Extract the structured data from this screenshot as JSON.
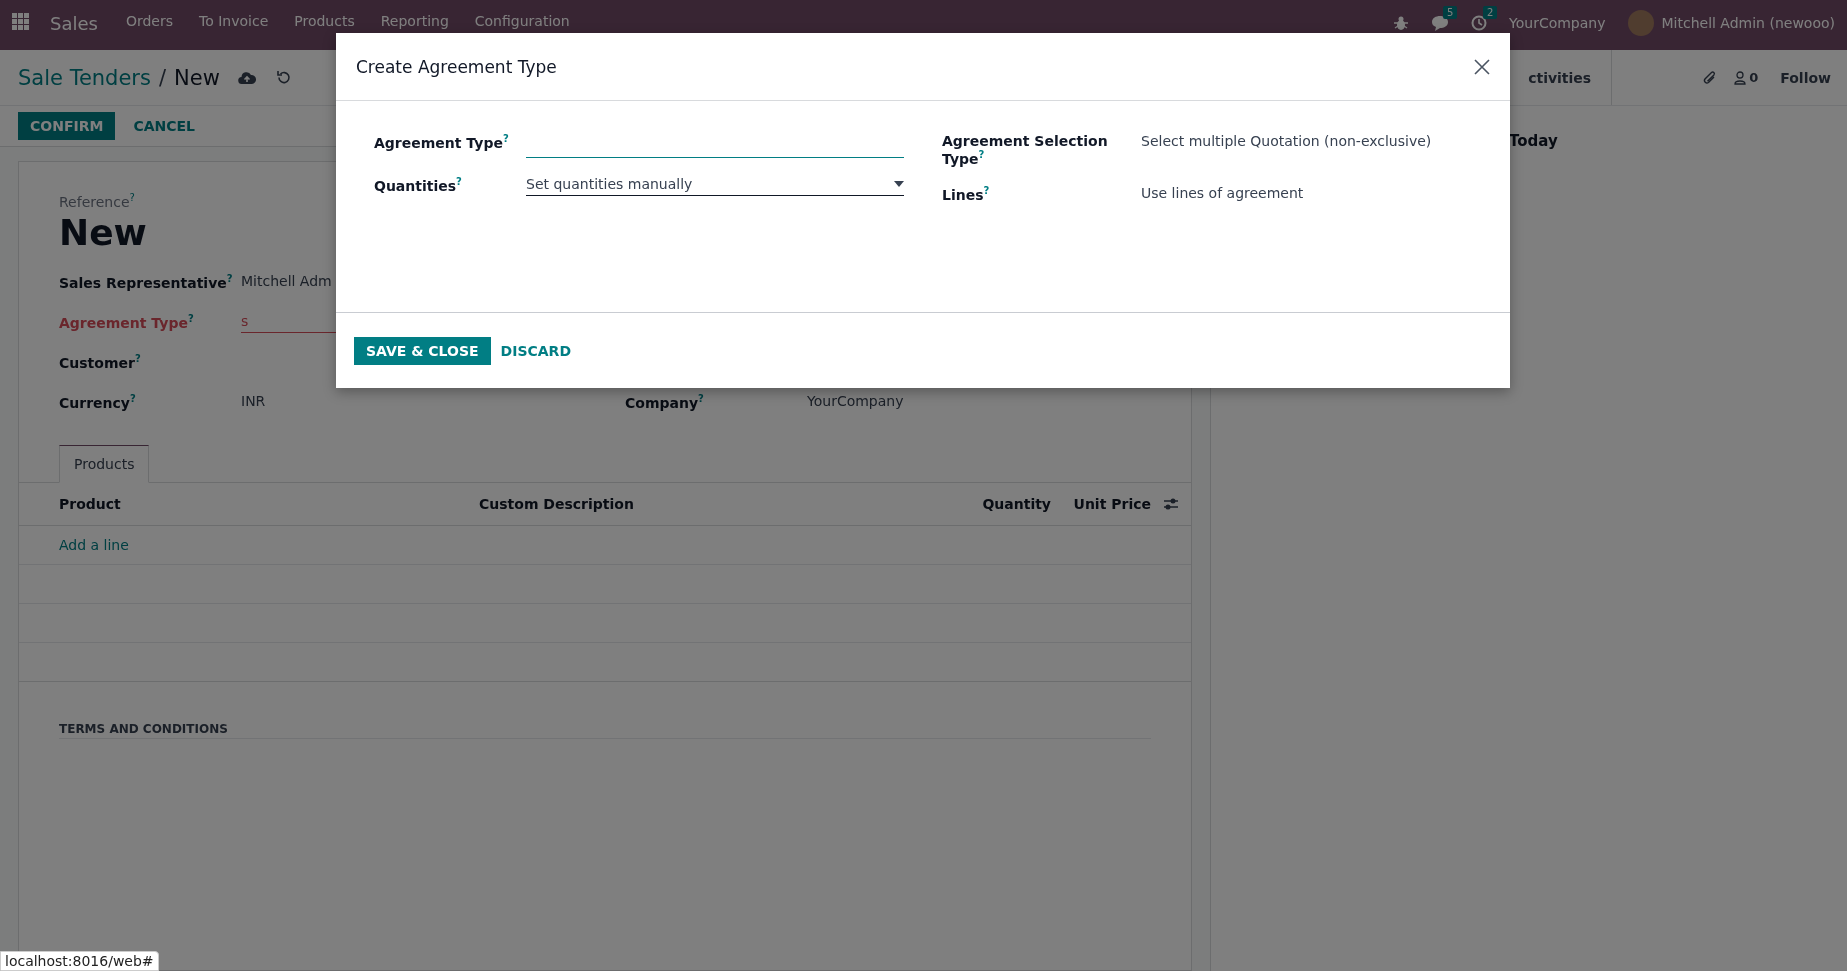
{
  "navbar": {
    "app": "Sales",
    "menu": [
      "Orders",
      "To Invoice",
      "Products",
      "Reporting",
      "Configuration"
    ],
    "messages_count": "5",
    "activities_count": "2",
    "company": "YourCompany",
    "user": "Mitchell Admin (newooo)"
  },
  "breadcrumb": {
    "parent": "Sale Tenders",
    "separator": "/",
    "current": "New"
  },
  "actions": [
    {
      "label": "CONFIRM",
      "kind": "primary"
    },
    {
      "label": "CANCEL",
      "kind": "secondary"
    }
  ],
  "chatter": {
    "activities": "ctivities",
    "followers": "0",
    "follow": "Follow",
    "today": "Today"
  },
  "form": {
    "reference_label": "Reference$^{?}$",
    "reference": "New",
    "fields": [
      {
        "label": "Sales Representative$^{?}$",
        "value": "Mitchell Adm",
        "invalid": false
      },
      {
        "label": "Agreement Type$^{?}$",
        "value": "s",
        "invalid": true
      },
      {
        "label": "Customer$^{?}$",
        "invalid": false
      },
      {
        "label": "Currency$^{?}$",
        "value": "INR",
        "invalid": false
      }
    ],
    "company_field": {
      "label": "Company$^{?}$",
      "value": "YourCompany"
    },
    "tabs": [
      {
        "label": "Products",
        "selected": true
      }
    ],
    "columns": [
      "Product",
      "Custom Description",
      "Quantity",
      "Unit Price"
    ],
    "add_line": "Add a line",
    "terms_label": "TERMS AND CONDITIONS"
  },
  "dialog": {
    "title": "Create Agreement Type",
    "fields_left": [
      {
        "label": "Agreement Type$^{?}$",
        "kind": "input"
      },
      {
        "label": "Quantities$^{?}$",
        "kind": "select",
        "value": "Set quantities manually"
      }
    ],
    "fields_right": [
      {
        "label": "Agreement Selection Type$^{?}$",
        "value": "Select multiple Quotation (non-exclusive)"
      },
      {
        "label": "Lines$^{?}$",
        "value": "Use lines of agreement"
      }
    ],
    "buttons": [
      {
        "label": "SAVE & CLOSE",
        "kind": "primary"
      },
      {
        "label": "DISCARD",
        "kind": "secondary"
      }
    ]
  },
  "status_url": "localhost:8016/web#"
}
